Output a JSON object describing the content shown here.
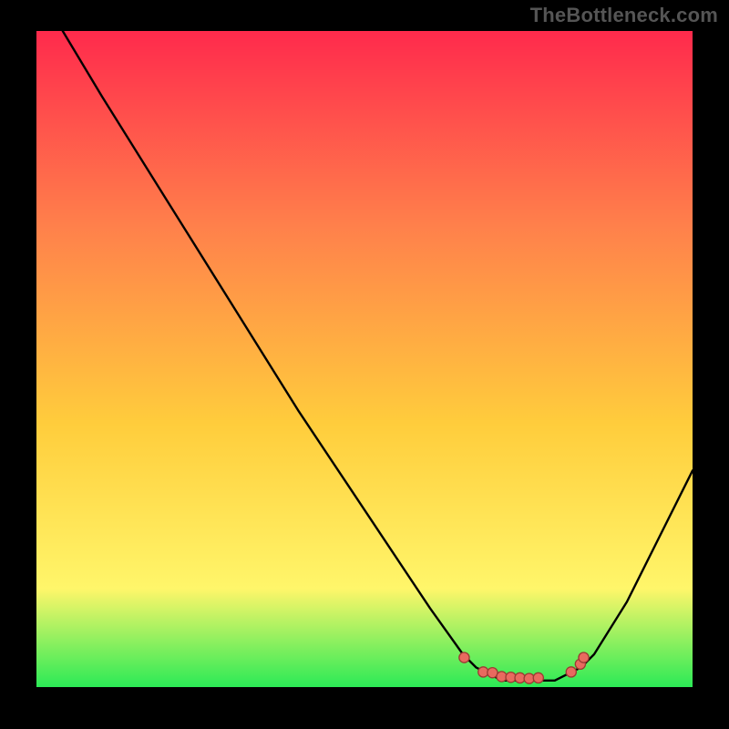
{
  "branding": {
    "watermark": "TheBottleneck.com"
  },
  "palette": {
    "frame": "#000000",
    "curve": "#000000",
    "dot_fill": "#e86a5f",
    "dot_stroke": "#9c3b33",
    "grad_top": "#ff2a4c",
    "grad_mid_high": "#ff814b",
    "grad_mid": "#ffcd3c",
    "grad_low": "#fff66a",
    "grad_bottom": "#2bea56"
  },
  "chart_data": {
    "type": "line",
    "title": "",
    "xlabel": "",
    "ylabel": "",
    "ylim": [
      0,
      100
    ],
    "x": [
      0.04,
      0.1,
      0.2,
      0.3,
      0.4,
      0.5,
      0.6,
      0.65,
      0.67,
      0.69,
      0.71,
      0.73,
      0.75,
      0.77,
      0.79,
      0.81,
      0.83,
      0.85,
      0.9,
      0.95,
      1.0
    ],
    "values": [
      100,
      90,
      74,
      58,
      42,
      27,
      12,
      5,
      3,
      2,
      1,
      1,
      1,
      1,
      1,
      2,
      3,
      5,
      13,
      23,
      33
    ],
    "dots": [
      {
        "x": 0.652,
        "y": 4.5
      },
      {
        "x": 0.681,
        "y": 2.3
      },
      {
        "x": 0.695,
        "y": 2.2
      },
      {
        "x": 0.709,
        "y": 1.6
      },
      {
        "x": 0.723,
        "y": 1.5
      },
      {
        "x": 0.737,
        "y": 1.4
      },
      {
        "x": 0.751,
        "y": 1.3
      },
      {
        "x": 0.765,
        "y": 1.4
      },
      {
        "x": 0.815,
        "y": 2.3
      },
      {
        "x": 0.829,
        "y": 3.5
      },
      {
        "x": 0.834,
        "y": 4.5
      }
    ],
    "note": "x is normalized 0-1 along the horizontal axis of the gradient panel; values (and dot y) are along the vertical axis where 0 is the bottom edge and 100 is the top edge of the colored plot area."
  }
}
